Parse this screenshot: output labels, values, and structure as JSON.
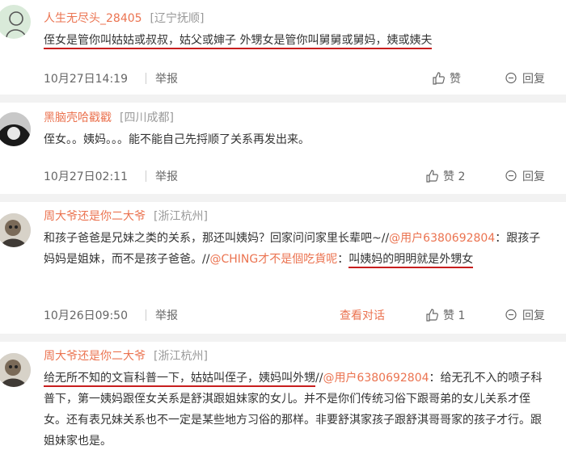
{
  "comments": [
    {
      "user": "人生无尽头_28405",
      "location": "[辽宁抚顺]",
      "text1": "侄女是管你叫姑姑或叔叔，姑父或婶子 外甥女是管你叫舅舅或舅妈，姨或姨夫",
      "time": "10月27日14:19",
      "report": "举报",
      "like_label": "赞",
      "reply_label": "回复"
    },
    {
      "user": "黑脑壳哈戳戳",
      "location": "[四川成都]",
      "text1": "侄女。。姨妈。。。能不能自己先捋顺了关系再发出来。",
      "time": "10月27日02:11",
      "report": "举报",
      "like_label": "赞 2",
      "reply_label": "回复"
    },
    {
      "user": "周大爷还是你二大爷",
      "location": "[浙江杭州]",
      "text_a": "和孩子爸爸是兄妹之类的关系，那还叫姨妈？回家问问家里长辈吧~//",
      "mention_a": "@用户6380692804",
      "text_b": "：跟孩子妈妈是姐妹，而不是孩子爸爸。//",
      "mention_b": "@CHING才不是個吃貨呢",
      "text_c": "：",
      "text_ul": "叫姨妈的明明就是外甥女",
      "time": "10月26日09:50",
      "report": "举报",
      "conversation": "查看对话",
      "like_label": "赞 1",
      "reply_label": "回复"
    },
    {
      "user": "周大爷还是你二大爷",
      "location": "[浙江杭州]",
      "text_ul": "给无所不知的文盲科普一下，姑姑叫侄子，姨妈叫外甥",
      "text_a": "//",
      "mention_a": "@用户6380692804",
      "text_b": "：给无孔不入的喷子科普下，第一姨妈跟侄女关系是舒淇跟姐妹家的女儿。并不是你们传统习俗下跟哥弟的女儿关系才侄女。还有表兄妹关系也不一定是某些地方习俗的那样。非要舒淇家孩子跟舒淇哥哥家的孩子才行。跟姐妹家也是。"
    }
  ],
  "colors": {
    "username": "#eb7350",
    "underline": "#c81e1e",
    "separator": "#f2f2f2"
  }
}
